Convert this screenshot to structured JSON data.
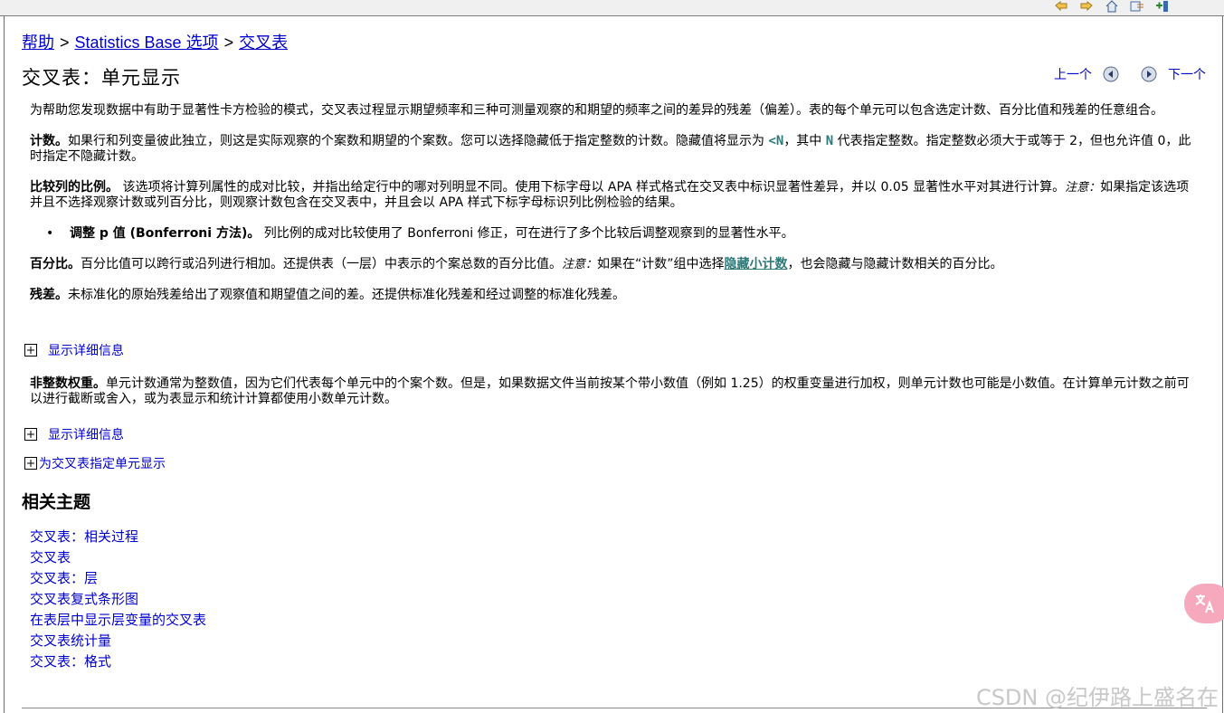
{
  "breadcrumb": {
    "item1": "帮助",
    "sep1": ">",
    "item2": "Statistics Base 选项",
    "sep2": ">",
    "item3": "交叉表"
  },
  "page_title": "交叉表：单元显示",
  "nav": {
    "prev_label": "上一个",
    "next_label": "下一个"
  },
  "intro": "为帮助您发现数据中有助于显著性卡方检验的模式，交叉表过程显示期望频率和三种可测量观察的和期望的频率之间的差异的残差（偏差）。表的每个单元可以包含选定计数、百分比值和残差的任意组合。",
  "counts": {
    "term": "计数。",
    "text_a": "如果行和列变量彼此独立，则这是实际观察的个案数和期望的个案数。您可以选择隐藏低于指定整数的计数。隐藏值将显示为 ",
    "code1": "<N",
    "text_b": "，其中 ",
    "code2": "N",
    "text_c": " 代表指定整数。指定整数必须大于或等于 2，但也允许值 0，此时指定不隐藏计数。"
  },
  "compare": {
    "term": "比较列的比例。",
    "text_a": " 该选项将计算列属性的成对比较，并指出给定行中的哪对列明显不同。使用下标字母以 APA 样式格式在交叉表中标识显著性差异，并以 0.05 显著性水平对其进行计算。",
    "note_label": "注意：",
    "text_b": "如果指定该选项并且不选择观察计数或列百分比，则观察计数包含在交叉表中，并且会以 APA 样式下标字母标识列比例检验的结果。"
  },
  "adjust": {
    "bullet": "•",
    "term": "调整 p 值 (Bonferroni 方法)。",
    "text": " 列比例的成对比较使用了 Bonferroni 修正，可在进行了多个比较后调整观察到的显著性水平。"
  },
  "percent": {
    "term": "百分比。",
    "text_a": "百分比值可以跨行或沿列进行相加。还提供表（一层）中表示的个案总数的百分比值。",
    "note_label": "注意：",
    "text_b": "如果在“计数”组中选择",
    "link": "隐藏小计数",
    "text_c": "，也会隐藏与隐藏计数相关的百分比。"
  },
  "residual": {
    "term": "残差。",
    "text": "未标准化的原始残差给出了观察值和期望值之间的差。还提供标准化残差和经过调整的标准化残差。"
  },
  "expander1": "显示详细信息",
  "nonint": {
    "term": "非整数权重。",
    "text": "单元计数通常为整数值，因为它们代表每个单元中的个案个数。但是，如果数据文件当前按某个带小数值（例如 1.25）的权重变量进行加权，则单元计数也可能是小数值。在计算单元计数之前可以进行截断或舍入，或为表显示和统计计算都使用小数单元计数。"
  },
  "expander2": "显示详细信息",
  "expander3": "为交叉表指定单元显示",
  "related_title": "相关主题",
  "related": [
    "交叉表：相关过程",
    "交叉表",
    "交叉表：层",
    "交叉表复式条形图",
    "在表层中显示层变量的交叉表",
    "交叉表统计量",
    "交叉表：格式"
  ],
  "watermark": "CSDN @纪伊路上盛名在",
  "translate_icon": "translate-icon"
}
